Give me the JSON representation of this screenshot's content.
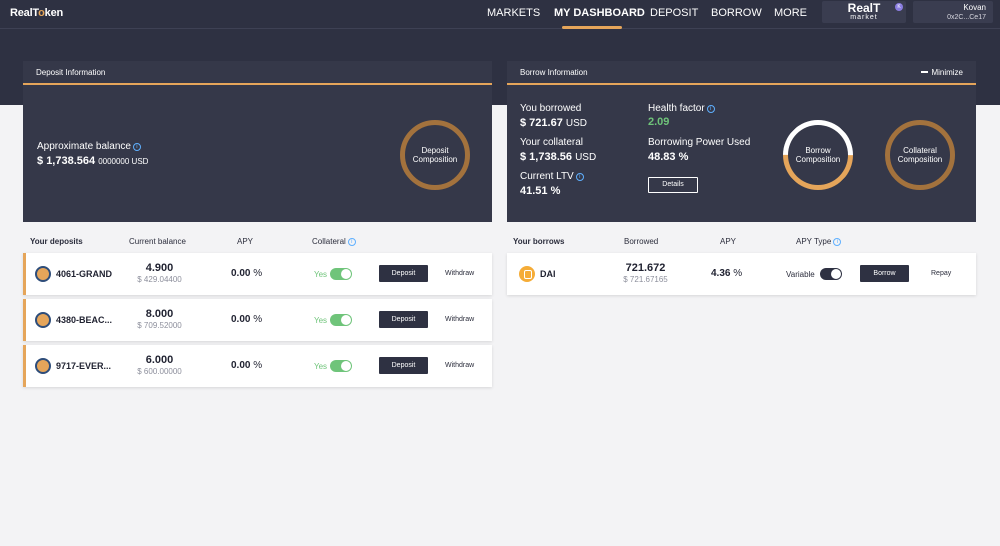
{
  "header": {
    "logo": {
      "part1": "RealT",
      "part2": "oken",
      "accent_letter": "O"
    },
    "nav": [
      "MARKETS",
      "MY DASHBOARD",
      "DEPOSIT",
      "BORROW",
      "MORE"
    ],
    "market_badge": {
      "title": "RealT",
      "subtitle": "market",
      "network_letter": "K"
    },
    "account": {
      "network": "Kovan",
      "address": "0x2C...Ce17"
    }
  },
  "deposit_panel": {
    "title": "Deposit Information",
    "balance_label": "Approximate balance",
    "balance_prefix": "$",
    "balance_main": "1,738.564",
    "balance_rest": "0000000 USD",
    "ring_label": "Deposit Composition"
  },
  "borrow_panel": {
    "title": "Borrow Information",
    "minimize": "Minimize",
    "borrowed_label": "You borrowed",
    "borrowed_value": "$ 721.67",
    "borrowed_unit": "USD",
    "collateral_label": "Your collateral",
    "collateral_value": "$ 1,738.56",
    "collateral_unit": "USD",
    "ltv_label": "Current LTV",
    "ltv_value": "41.51 %",
    "health_label": "Health factor",
    "health_value": "2.09",
    "power_label": "Borrowing Power Used",
    "power_value": "48.83 %",
    "details_button": "Details",
    "ring_borrow": "Borrow Composition",
    "ring_collateral": "Collateral Composition"
  },
  "deposits": {
    "headers": {
      "asset": "Your deposits",
      "balance": "Current balance",
      "apy": "APY",
      "collateral": "Collateral"
    },
    "rows": [
      {
        "asset": "4061-GRAND",
        "amount": "4.900",
        "usd": "$ 429.04400",
        "apy": "0.00",
        "pct": "%",
        "collateral": "Yes",
        "deposit": "Deposit",
        "withdraw": "Withdraw"
      },
      {
        "asset": "4380-BEAC...",
        "amount": "8.000",
        "usd": "$ 709.52000",
        "apy": "0.00",
        "pct": "%",
        "collateral": "Yes",
        "deposit": "Deposit",
        "withdraw": "Withdraw"
      },
      {
        "asset": "9717-EVER...",
        "amount": "6.000",
        "usd": "$ 600.00000",
        "apy": "0.00",
        "pct": "%",
        "collateral": "Yes",
        "deposit": "Deposit",
        "withdraw": "Withdraw"
      }
    ]
  },
  "borrows": {
    "headers": {
      "asset": "Your borrows",
      "borrowed": "Borrowed",
      "apy": "APY",
      "apy_type": "APY Type"
    },
    "rows": [
      {
        "asset": "DAI",
        "amount": "721.672",
        "usd": "$ 721.67165",
        "apy": "4.36",
        "pct": "%",
        "apy_type": "Variable",
        "borrow": "Borrow",
        "repay": "Repay"
      }
    ]
  },
  "colors": {
    "accent": "#e5a55a",
    "panel": "#353849",
    "nav": "#2e3142",
    "green": "#6fc47a",
    "info": "#5fb0ff"
  }
}
